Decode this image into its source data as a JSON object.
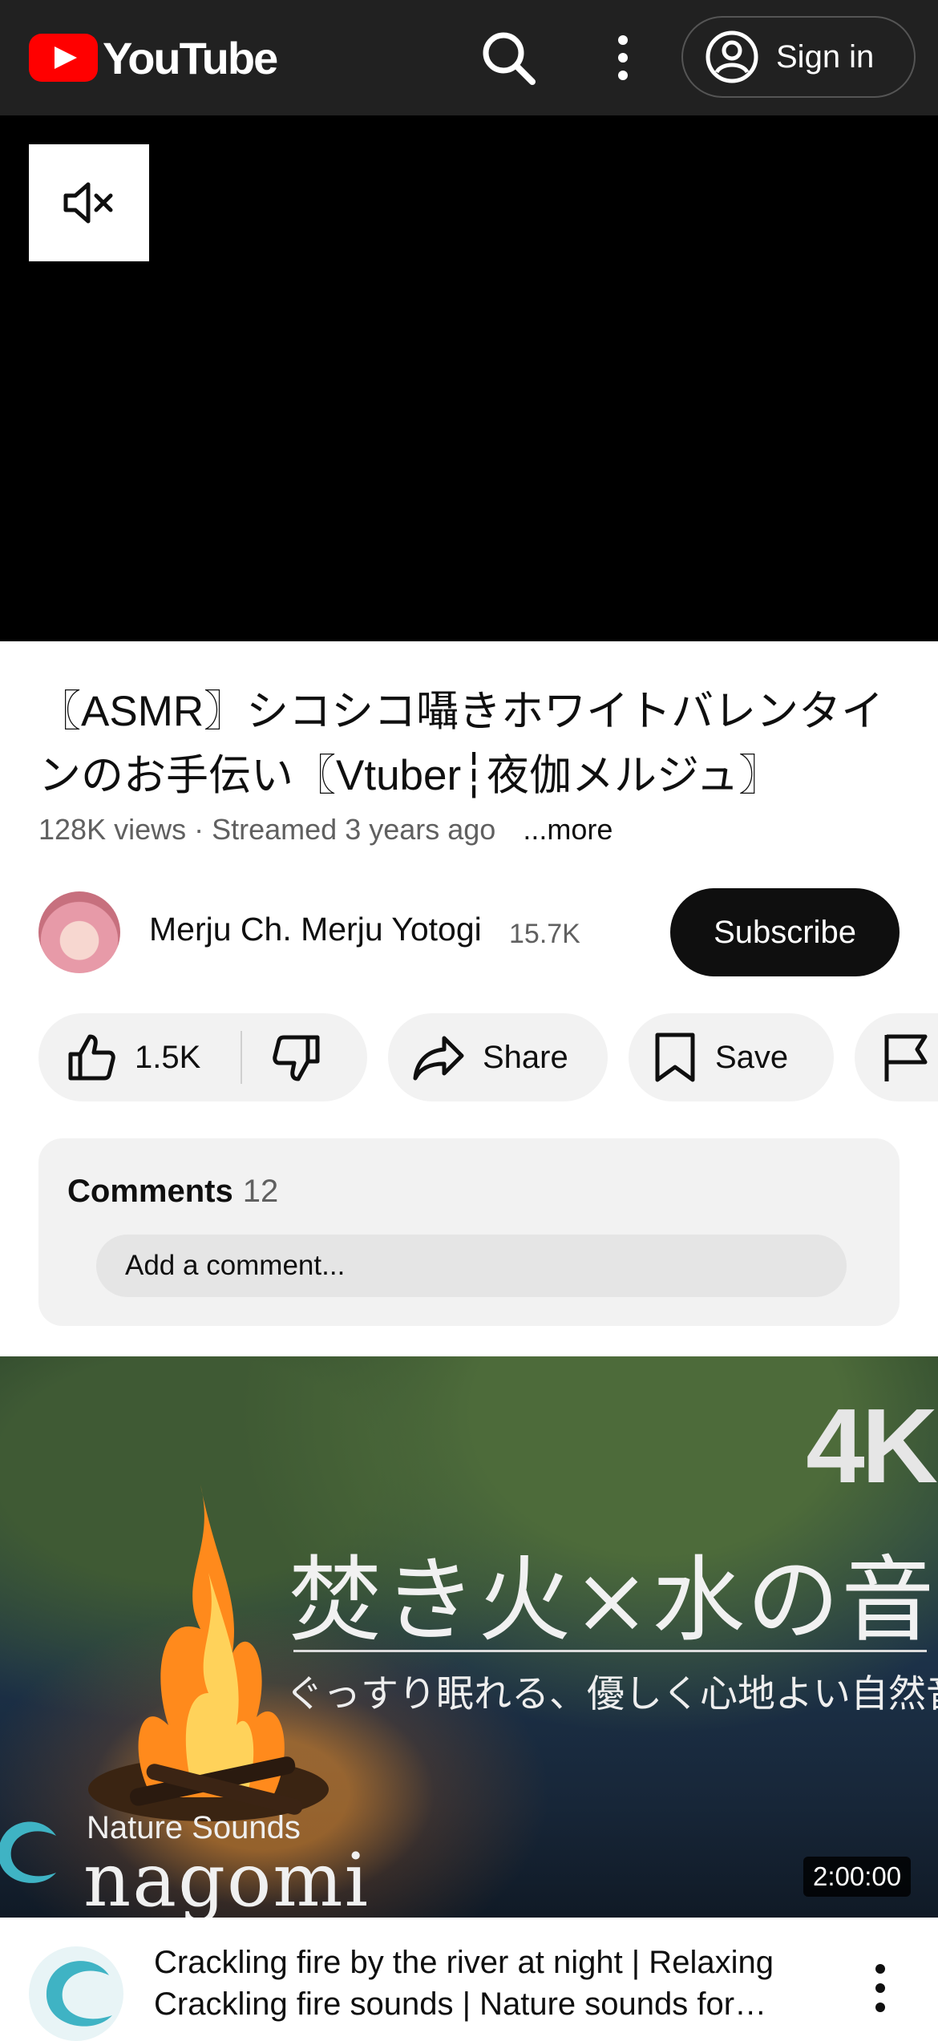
{
  "header": {
    "logo_text": "YouTube",
    "search_icon": "search-icon",
    "more_icon": "more-vert-icon",
    "signin_label": "Sign in"
  },
  "player": {
    "mute_icon": "volume-muted-icon"
  },
  "video": {
    "title": "〖ASMR〗シコシコ囁きホワイトバレンタインのお手伝い〖Vtuber┆夜伽メルジュ〗",
    "views": "128K views",
    "streamed": "· Streamed 3 years ago",
    "more_label": "...more"
  },
  "channel": {
    "name": "Merju Ch. Merju Yotogi",
    "subscribers": "15.7K",
    "subscribe_label": "Subscribe"
  },
  "actions": {
    "like_count": "1.5K",
    "share_label": "Share",
    "save_label": "Save"
  },
  "comments": {
    "label": "Comments",
    "count": "12",
    "placeholder": "Add a comment..."
  },
  "recommended": {
    "thumb_badge": "4K",
    "thumb_title": "焚き火×水の音",
    "thumb_subtitle": "ぐっすり眠れる、優しく心地よい自然音",
    "thumb_brand_top": "Nature Sounds",
    "thumb_brand": "nagomi",
    "duration": "2:00:00",
    "title": "Crackling fire by the river at night | Relaxing Crackling fire sounds | Nature sounds for…"
  },
  "colors": {
    "brand_red": "#ff0000",
    "header_bg": "#212121",
    "subscribe_bg": "#0f0f0f",
    "pill_bg": "#f2f2f2"
  }
}
